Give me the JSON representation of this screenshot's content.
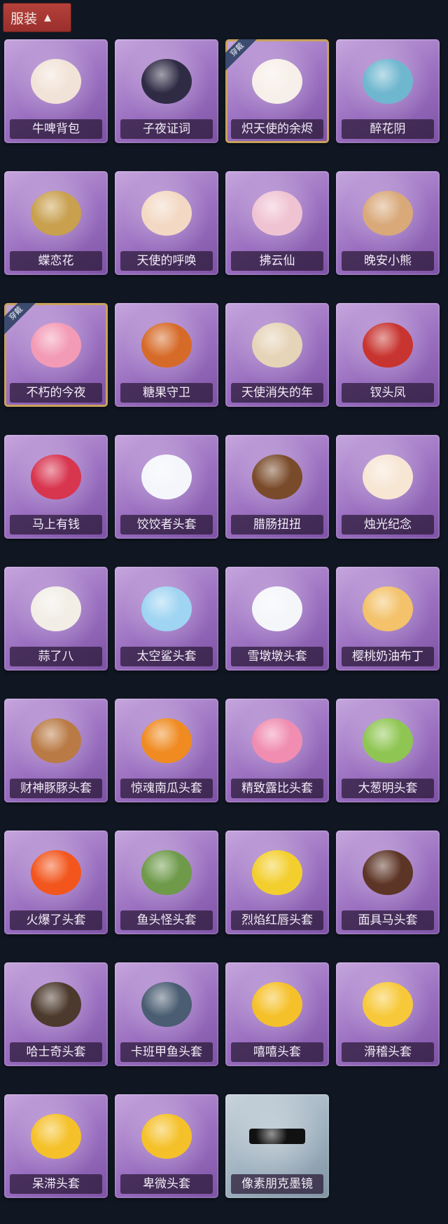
{
  "header": {
    "title": "服装"
  },
  "items": [
    {
      "label": "牛啤背包",
      "icon": "cow-beer-backpack-icon",
      "color": "#f2e3d8"
    },
    {
      "label": "子夜证词",
      "icon": "plague-doctor-icon",
      "color": "#2f2b45"
    },
    {
      "label": "炽天使的余烬",
      "icon": "angel-girl-icon",
      "color": "#f7efe9",
      "tag": "穿戴"
    },
    {
      "label": "醉花阴",
      "icon": "flower-lantern-icon",
      "color": "#6fb7cf"
    },
    {
      "label": "蝶恋花",
      "icon": "butterfly-bell-icon",
      "color": "#c8a04e"
    },
    {
      "label": "天使的呼唤",
      "icon": "cherub-icon",
      "color": "#f3d9c4"
    },
    {
      "label": "拂云仙",
      "icon": "cloud-fairy-icon",
      "color": "#f0c3d3"
    },
    {
      "label": "晚安小熊",
      "icon": "teddy-bear-icon",
      "color": "#d9a97a"
    },
    {
      "label": "不朽的今夜",
      "icon": "pink-cat-cup-icon",
      "color": "#f39bb6",
      "tag": "穿戴"
    },
    {
      "label": "糖果守卫",
      "icon": "pumpkin-scarecrow-icon",
      "color": "#d66a28"
    },
    {
      "label": "天使消失的年",
      "icon": "halo-girl-icon",
      "color": "#e6d4b8"
    },
    {
      "label": "钗头凤",
      "icon": "phoenix-crown-icon",
      "color": "#c8342f"
    },
    {
      "label": "马上有钱",
      "icon": "red-horse-head-icon",
      "color": "#d8354f"
    },
    {
      "label": "饺饺者头套",
      "icon": "dumpling-head-icon",
      "color": "#f4f6fb"
    },
    {
      "label": "腊肠扭扭",
      "icon": "dachshund-head-icon",
      "color": "#7a4b2a"
    },
    {
      "label": "烛光纪念",
      "icon": "candle-head-icon",
      "color": "#f7e6d4"
    },
    {
      "label": "蒜了八",
      "icon": "garlic-head-icon",
      "color": "#f2eee6"
    },
    {
      "label": "太空鲨头套",
      "icon": "shark-head-icon",
      "color": "#9fd4f2"
    },
    {
      "label": "雪墩墩头套",
      "icon": "snowman-head-icon",
      "color": "#f5f6fa"
    },
    {
      "label": "樱桃奶油布丁",
      "icon": "pudding-head-icon",
      "color": "#f3c26a"
    },
    {
      "label": "财神豚豚头套",
      "icon": "capybara-head-icon",
      "color": "#b97a45"
    },
    {
      "label": "惊魂南瓜头套",
      "icon": "pumpkin-head-icon",
      "color": "#ef8b21"
    },
    {
      "label": "精致露比头套",
      "icon": "pink-beaver-head-icon",
      "color": "#f08db0"
    },
    {
      "label": "大葱明头套",
      "icon": "scallion-head-icon",
      "color": "#8fc653"
    },
    {
      "label": "火爆了头套",
      "icon": "fire-head-icon",
      "color": "#f2561d"
    },
    {
      "label": "鱼头怪头套",
      "icon": "fish-head-icon",
      "color": "#6e9a4a"
    },
    {
      "label": "烈焰红唇头套",
      "icon": "yellow-mouse-sunglasses-icon",
      "color": "#f3cf2e"
    },
    {
      "label": "面具马头套",
      "icon": "horse-head-mask-icon",
      "color": "#5d3526"
    },
    {
      "label": "哈士奇头套",
      "icon": "husky-sunglasses-icon",
      "color": "#4d3a2e"
    },
    {
      "label": "卡班甲鱼头套",
      "icon": "fish-face-icon",
      "color": "#4a5d72"
    },
    {
      "label": "嘻嘻头套",
      "icon": "grin-emoji-icon",
      "color": "#f5c12a"
    },
    {
      "label": "滑稽头套",
      "icon": "smirk-emoji-icon",
      "color": "#f7c93a"
    },
    {
      "label": "呆滞头套",
      "icon": "dazed-emoji-icon",
      "color": "#f5c12a"
    },
    {
      "label": "卑微头套",
      "icon": "pleading-emoji-icon",
      "color": "#f5c12a"
    },
    {
      "label": "像素朋克墨镜",
      "icon": "pixel-sunglasses-icon",
      "color": "#111111",
      "gray": true
    }
  ]
}
